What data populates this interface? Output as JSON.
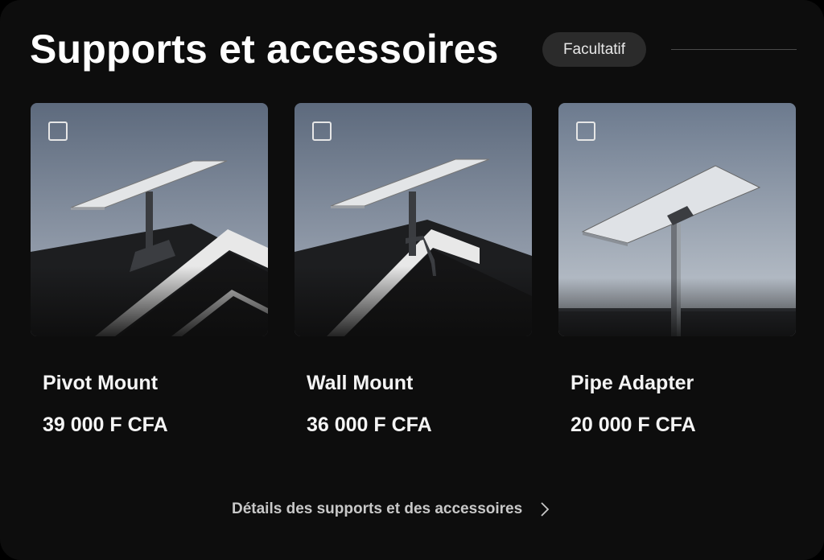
{
  "section": {
    "title": "Supports et accessoires",
    "badge": "Facultatif"
  },
  "products": [
    {
      "name": "Pivot Mount",
      "price": "39 000 F CFA",
      "image_icon": "pivot-mount-photo",
      "checked": false
    },
    {
      "name": "Wall Mount",
      "price": "36 000 F CFA",
      "image_icon": "wall-mount-photo",
      "checked": false
    },
    {
      "name": "Pipe Adapter",
      "price": "20 000 F CFA",
      "image_icon": "pipe-adapter-photo",
      "checked": false
    }
  ],
  "details_link": {
    "label": "Détails des supports et des accessoires",
    "icon": "chevron-right-icon"
  },
  "colors": {
    "background": "#0d0d0d",
    "badge_bg": "#2b2b2b",
    "text": "#f4f4f4",
    "muted_text": "#c8c8c8"
  }
}
